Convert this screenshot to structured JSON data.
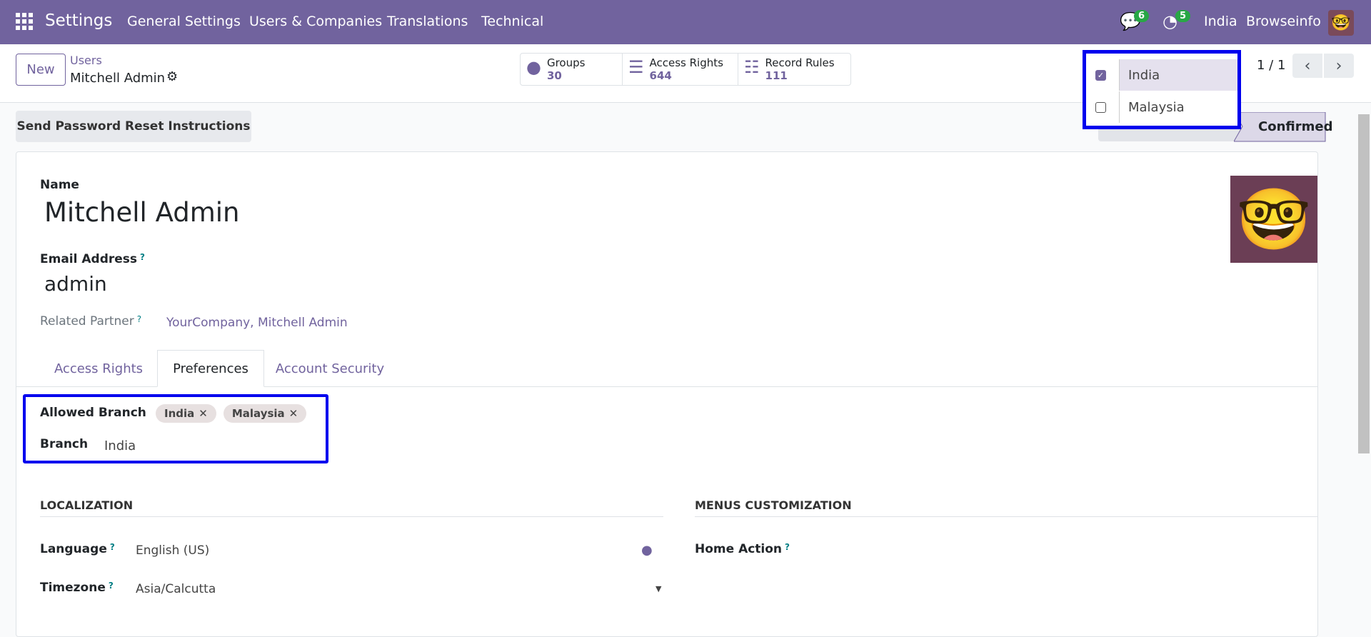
{
  "navbar": {
    "app": "Settings",
    "menus": [
      "General Settings",
      "Users & Companies",
      "Translations",
      "Technical"
    ],
    "messages_count": "6",
    "activities_count": "5",
    "branch": "India",
    "company": "Browseinfo"
  },
  "control": {
    "new_label": "New",
    "breadcrumb_parent": "Users",
    "breadcrumb_current": "Mitchell Admin",
    "smart_buttons": [
      {
        "label": "Groups",
        "value": "30"
      },
      {
        "label": "Access Rights",
        "value": "644"
      },
      {
        "label": "Record Rules",
        "value": "111"
      }
    ],
    "pager": "1 / 1"
  },
  "branch_dropdown": [
    {
      "label": "India",
      "checked": true
    },
    {
      "label": "Malaysia",
      "checked": false
    }
  ],
  "actions": {
    "reset_password": "Send Password Reset Instructions",
    "status": "Confirmed"
  },
  "form": {
    "name_label": "Name",
    "name": "Mitchell Admin",
    "email_label": "Email Address",
    "email": "admin",
    "partner_label": "Related Partner",
    "partner": "YourCompany, Mitchell Admin",
    "tabs": [
      "Access Rights",
      "Preferences",
      "Account Security"
    ],
    "active_tab": "Preferences",
    "allowed_branch_label": "Allowed Branch",
    "allowed_branches": [
      "India",
      "Malaysia"
    ],
    "branch_label": "Branch",
    "branch": "India",
    "localization_title": "LOCALIZATION",
    "language_label": "Language",
    "language": "English (US)",
    "timezone_label": "Timezone",
    "timezone": "Asia/Calcutta",
    "menus_title": "MENUS CUSTOMIZATION",
    "home_action_label": "Home Action"
  },
  "colors": {
    "brand": "#71639e",
    "highlight": "#0000ee"
  }
}
